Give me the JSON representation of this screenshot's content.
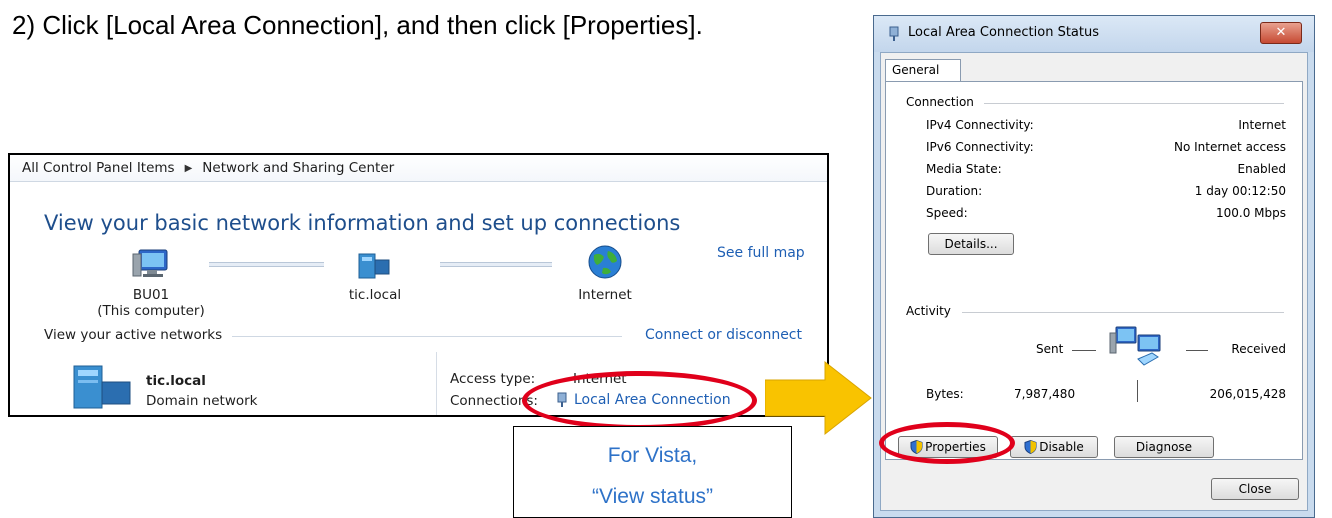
{
  "instruction": "2) Click [Local Area Connection], and then click [Properties].",
  "control_panel": {
    "breadcrumb": [
      "All Control Panel Items",
      "Network and Sharing Center"
    ],
    "heading": "View your basic network information and set up connections",
    "see_full_map": "See full map",
    "nodes": [
      {
        "name": "BU01",
        "sub": "(This computer)"
      },
      {
        "name": "tic.local",
        "sub": ""
      },
      {
        "name": "Internet",
        "sub": ""
      }
    ],
    "active_networks_label": "View your active networks",
    "connect_disconnect": "Connect or disconnect",
    "network_name": "tic.local",
    "network_type": "Domain network",
    "access_type_label": "Access type:",
    "access_type_value": "Internet",
    "connections_label": "Connections:",
    "connection_link": "Local Area Connection"
  },
  "callout": {
    "line1": "For Vista,",
    "line2": "“View status”"
  },
  "dialog": {
    "title": "Local Area Connection Status",
    "close_glyph": "✕",
    "tab": "General",
    "connection_group": "Connection",
    "rows": [
      {
        "label": "IPv4 Connectivity:",
        "value": "Internet"
      },
      {
        "label": "IPv6 Connectivity:",
        "value": "No Internet access"
      },
      {
        "label": "Media State:",
        "value": "Enabled"
      },
      {
        "label": "Duration:",
        "value": "1 day 00:12:50"
      },
      {
        "label": "Speed:",
        "value": "100.0 Mbps"
      }
    ],
    "details_button": "Details...",
    "activity_group": "Activity",
    "sent_label": "Sent",
    "received_label": "Received",
    "bytes_label": "Bytes:",
    "bytes_sent": "7,987,480",
    "bytes_received": "206,015,428",
    "properties_button": "Properties",
    "disable_button": "Disable",
    "diagnose_button": "Diagnose",
    "close_button": "Close"
  },
  "colors": {
    "highlight": "#e0001b",
    "arrow": "#f9c300",
    "link": "#1e5fb4"
  }
}
